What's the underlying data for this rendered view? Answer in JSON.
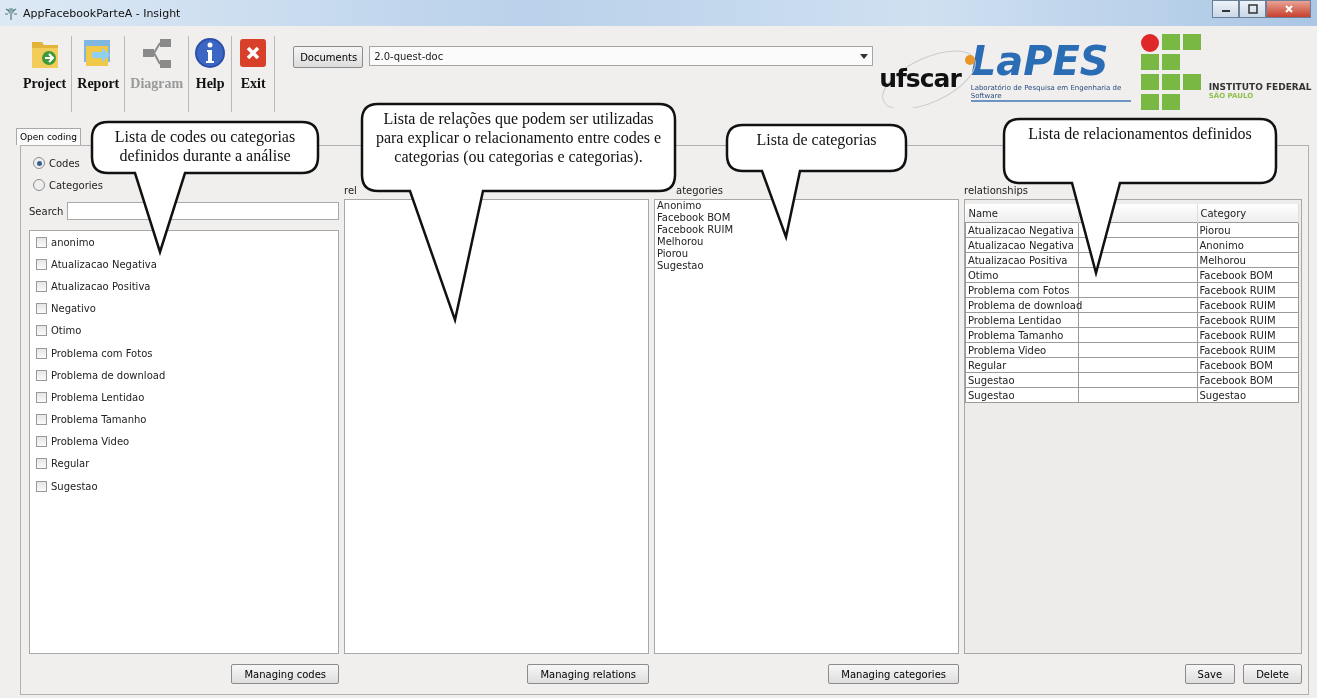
{
  "window": {
    "title": "AppFacebookParteA - Insight"
  },
  "toolbar": [
    {
      "label": "Project",
      "kind": "project",
      "disabled": false
    },
    {
      "label": "Report",
      "kind": "report",
      "disabled": false
    },
    {
      "label": "Diagram",
      "kind": "diagram",
      "disabled": true
    },
    {
      "label": "Help",
      "kind": "help",
      "disabled": false
    },
    {
      "label": "Exit",
      "kind": "exit",
      "disabled": false
    }
  ],
  "documents": {
    "button": "Documents",
    "value": "2.0-quest-doc"
  },
  "logos": [
    {
      "kind": "ufscar",
      "text": "ufscar"
    },
    {
      "kind": "lapes",
      "text": "LaPES",
      "subtitle": "Laboratório de Pesquisa em Engenharia de Software"
    },
    {
      "kind": "if",
      "text": "INSTITUTO FEDERAL",
      "subtitle": "SÃO PAULO"
    }
  ],
  "tabs": [
    {
      "label": "Open coding",
      "selected": true
    }
  ],
  "mode": [
    {
      "label": "Codes",
      "selected": true
    },
    {
      "label": "Categories",
      "selected": false
    }
  ],
  "search": {
    "label": "Search"
  },
  "codes": [
    {
      "label": "anonimo",
      "checked": false
    },
    {
      "label": "Atualizacao Negativa",
      "checked": false
    },
    {
      "label": "Atualizacao Positiva",
      "checked": false
    },
    {
      "label": "Negativo",
      "checked": false
    },
    {
      "label": "Otimo",
      "checked": false
    },
    {
      "label": "Problema com Fotos",
      "checked": false
    },
    {
      "label": "Problema de download",
      "checked": false
    },
    {
      "label": "Problema Lentidao",
      "checked": false
    },
    {
      "label": "Problema Tamanho",
      "checked": false
    },
    {
      "label": "Problema Video",
      "checked": false
    },
    {
      "label": "Regular",
      "checked": false
    },
    {
      "label": "Sugestao",
      "checked": false
    }
  ],
  "codes_button": "Managing codes",
  "relations": {
    "label": "rel",
    "button": "Managing relations"
  },
  "categories": {
    "label": "ategories",
    "items": [
      "Anonimo",
      "Facebook BOM",
      "Facebook RUIM",
      "Melhorou",
      "Piorou",
      "Sugestao"
    ],
    "button": "Managing categories"
  },
  "relationships": {
    "label": "relationships",
    "columns": [
      "Name",
      "",
      "Category"
    ],
    "rows": [
      [
        "Atualizacao Negativa",
        "",
        "Piorou"
      ],
      [
        "Atualizacao Negativa",
        "",
        "Anonimo"
      ],
      [
        "Atualizacao Positiva",
        "",
        "Melhorou"
      ],
      [
        "Otimo",
        "",
        "Facebook BOM"
      ],
      [
        "Problema com Fotos",
        "",
        "Facebook RUIM"
      ],
      [
        "Problema de download",
        "",
        "Facebook RUIM"
      ],
      [
        "Problema Lentidao",
        "",
        "Facebook RUIM"
      ],
      [
        "Problema Tamanho",
        "",
        "Facebook RUIM"
      ],
      [
        "Problema Video",
        "",
        "Facebook RUIM"
      ],
      [
        "Regular",
        "",
        "Facebook BOM"
      ],
      [
        "Sugestao",
        "",
        "Facebook BOM"
      ],
      [
        "Sugestao",
        "",
        "Sugestao"
      ]
    ],
    "buttons": [
      "Save",
      "Delete"
    ]
  },
  "callouts": [
    {
      "text": "Lista de codes ou categorias definidos durante a análise"
    },
    {
      "text": "Lista de relações que podem ser utilizadas para explicar o relacionamento entre codes e categorias (ou categorias e categorias)."
    },
    {
      "text": "Lista de categorias"
    },
    {
      "text": "Lista de relacionamentos definidos"
    }
  ]
}
